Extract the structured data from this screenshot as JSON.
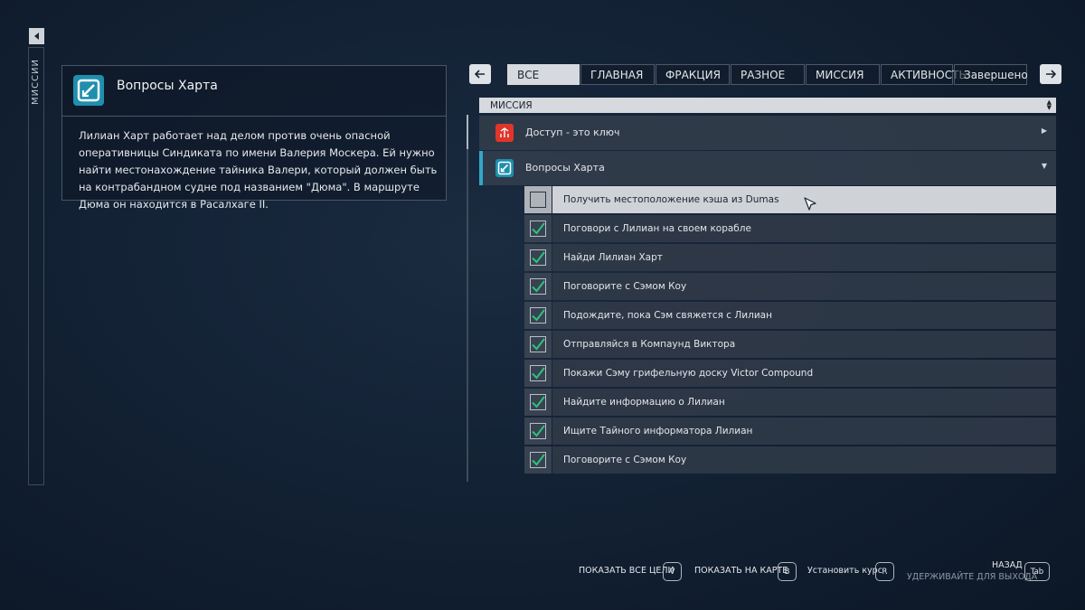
{
  "rail": {
    "label": "МИССИИ"
  },
  "detail": {
    "title": "Вопросы Харта",
    "description": "Лилиан Харт работает над делом против очень опасной оперативницы Синдиката по имени Валерия Москера. Ей нужно найти местонахождение тайника Валери, который должен быть на контрабандном судне под названием \"Дюма\". В маршруте Дюма он находится в Расалхаге II."
  },
  "tabs": [
    {
      "label": "ВСЕ",
      "active": true
    },
    {
      "label": "ГЛАВНАЯ",
      "active": false
    },
    {
      "label": "ФРАКЦИЯ",
      "active": false
    },
    {
      "label": "РАЗНОЕ",
      "active": false
    },
    {
      "label": "МИССИЯ",
      "active": false
    },
    {
      "label": "АКТИВНОСТЬ",
      "active": false
    },
    {
      "label": "Завершено",
      "active": false
    }
  ],
  "list": {
    "sort_label": "МИССИЯ",
    "missions": [
      {
        "name": "Доступ - это ключ",
        "icon": "red-emblem-icon",
        "color": "#e0352b",
        "expanded": false
      },
      {
        "name": "Вопросы Харта",
        "icon": "mission-icon",
        "color": "#1f8fae",
        "expanded": true
      }
    ],
    "objectives": [
      {
        "label": "Получить местоположение кэша из Dumas",
        "done": false,
        "selected": true
      },
      {
        "label": "Поговори с Лилиан на своем корабле",
        "done": true
      },
      {
        "label": "Найди Лилиан Харт",
        "done": true
      },
      {
        "label": "Поговорите с Сэмом Коу",
        "done": true
      },
      {
        "label": "Подождите, пока Сэм свяжется с Лилиан",
        "done": true
      },
      {
        "label": "Отправляйся в Компаунд Виктора",
        "done": true
      },
      {
        "label": "Покажи Сэму грифельную доску Victor Compound",
        "done": true
      },
      {
        "label": "Найдите информацию о Лилиан",
        "done": true
      },
      {
        "label": "Ищите Тайного информатора Лилиан",
        "done": true
      },
      {
        "label": "Поговорите с Сэмом Коу",
        "done": true
      }
    ]
  },
  "footer": {
    "show_all": {
      "label": "ПОКАЗАТЬ ВСЕ ЦЕЛИ",
      "key": "V"
    },
    "show_map": {
      "label": "ПОКАЗАТЬ НА КАРТЕ",
      "key": "B"
    },
    "set_course": {
      "label": "Установить курс",
      "key": "R"
    },
    "back": {
      "label": "НАЗАД",
      "sub": "УДЕРЖИВАЙТЕ ДЛЯ ВЫХОДА",
      "key": "Tab"
    }
  },
  "colors": {
    "accent": "#2fa8c9",
    "check": "#2ec27e"
  }
}
